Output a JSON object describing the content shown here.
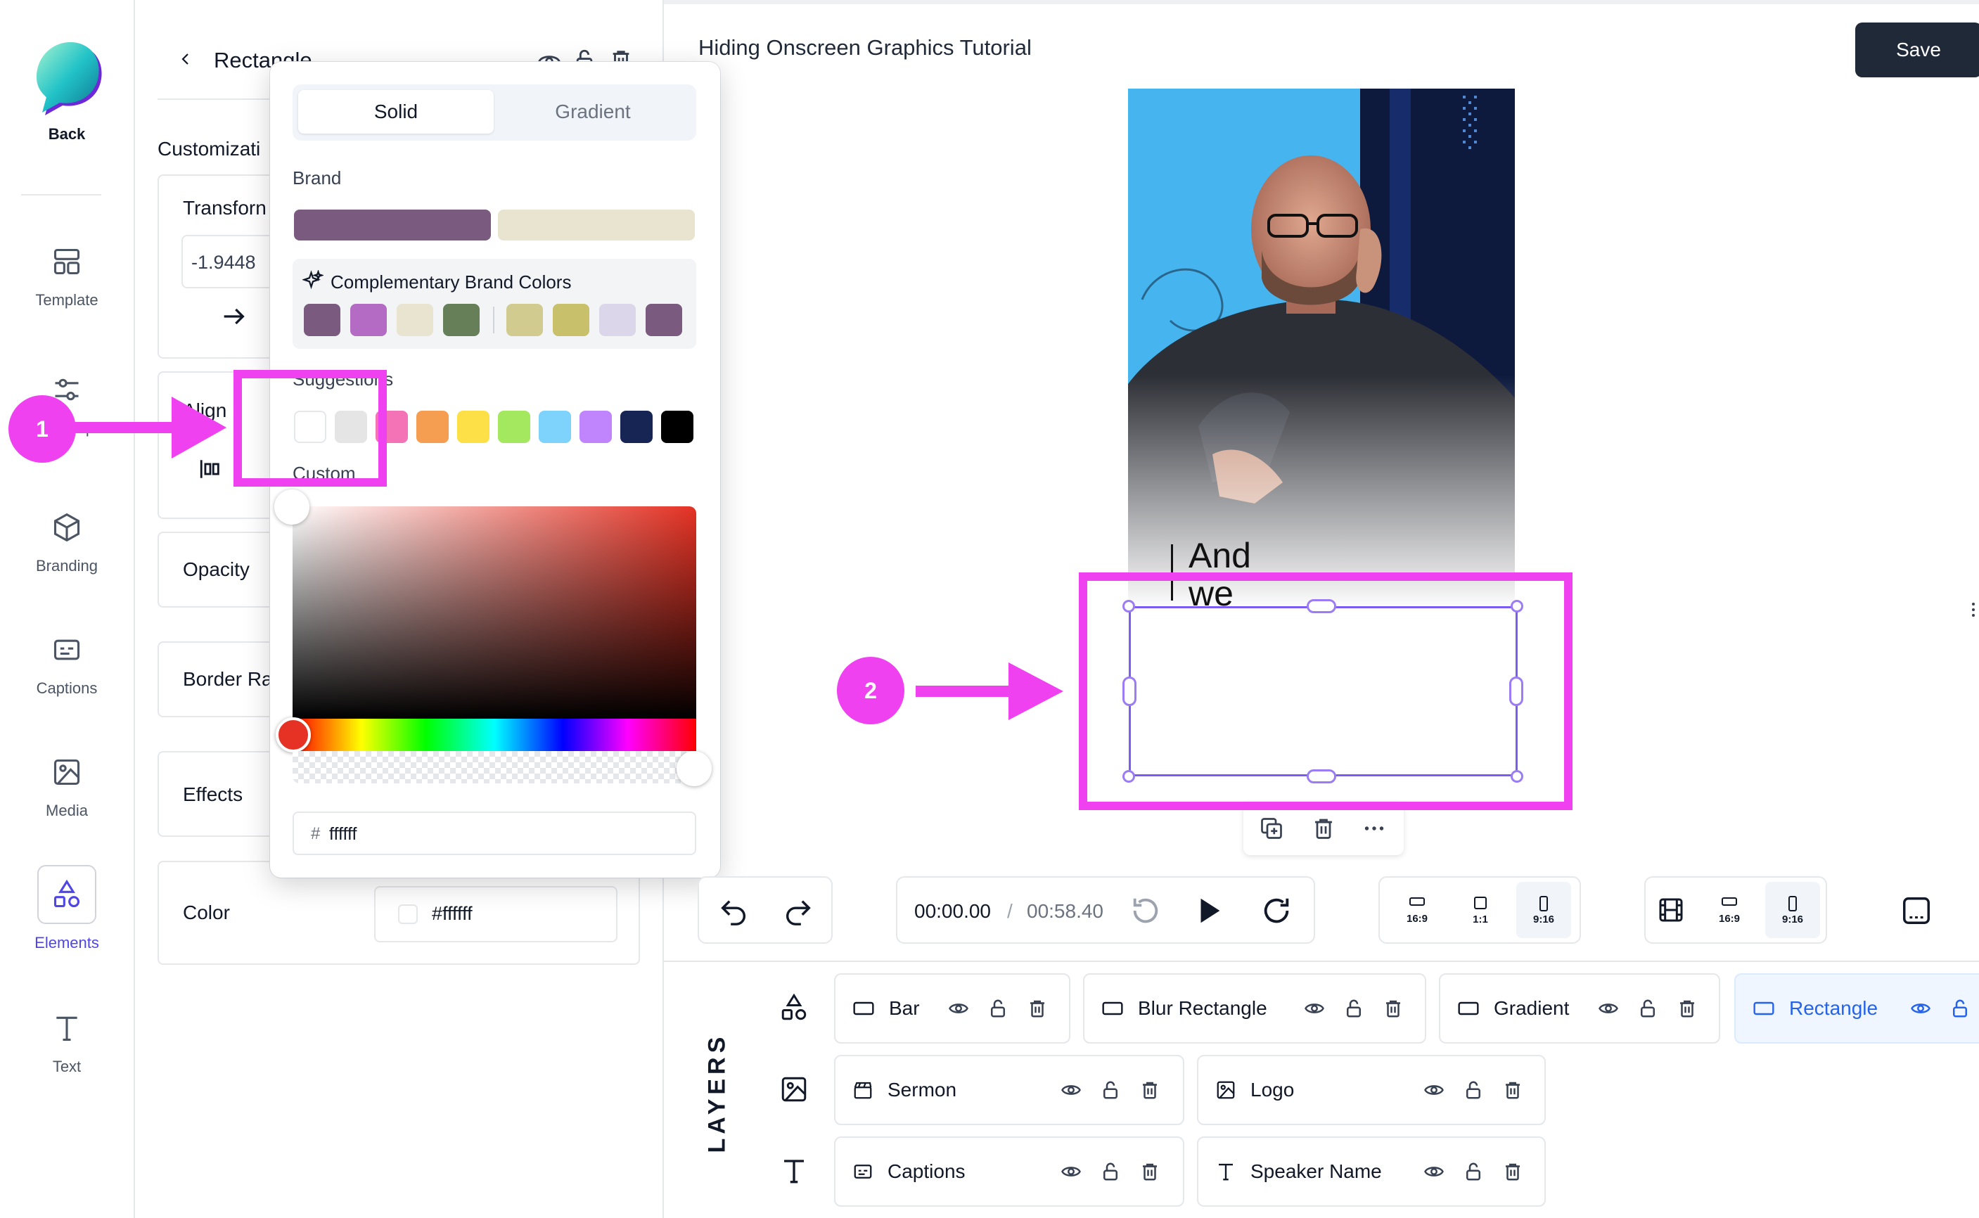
{
  "sidebar": {
    "back_label": "Back",
    "items": [
      {
        "label": "Template",
        "icon": "template-icon"
      },
      {
        "label": "Update Inputs",
        "icon": "sliders-icon"
      },
      {
        "label": "Branding",
        "icon": "cube-icon"
      },
      {
        "label": "Captions",
        "icon": "captions-icon"
      },
      {
        "label": "Media",
        "icon": "image-icon"
      },
      {
        "label": "Elements",
        "icon": "shapes-icon",
        "active": true
      },
      {
        "label": "Text",
        "icon": "text-icon"
      }
    ]
  },
  "panel": {
    "title": "Rectangle",
    "section": "Customizati",
    "transform_label": "Transforn",
    "transform_value": "-1.9448",
    "align_label": "Align",
    "opacity_label": "Opacity",
    "border_radius_label": "Border Ra",
    "effects_label": "Effects",
    "color_label": "Color",
    "color_value": "#ffffff"
  },
  "color_picker": {
    "tabs": [
      "Solid",
      "Gradient"
    ],
    "active_tab": "Solid",
    "brand_label": "Brand",
    "brand_colors": [
      "#7a5a7e",
      "#e8e4d0"
    ],
    "complementary_label": "Complementary Brand Colors",
    "complementary_colors": [
      "#7a5a7e",
      "#b36bc4",
      "#e8e4d0",
      "#667f58",
      "#d2cb8f",
      "#c9c06b",
      "#dcd6ea",
      "#7a5a7e"
    ],
    "suggestions_label": "Suggestions",
    "suggestion_colors": [
      "#ffffff",
      "#e5e5e5",
      "#f472b6",
      "#f59e52",
      "#fde047",
      "#a3e85f",
      "#7dd3fc",
      "#c084fc",
      "#172554",
      "#000000"
    ],
    "custom_label": "Custom",
    "hex_prefix": "#",
    "hex_value": "ffffff"
  },
  "main": {
    "title": "Hiding Onscreen Graphics Tutorial",
    "save_label": "Save",
    "caption_line1": "And",
    "caption_line2": "we"
  },
  "toolbar": {
    "current_time": "00:00.00",
    "separator": "/",
    "total_time": "00:58.40",
    "ratios_a": [
      "16:9",
      "1:1",
      "9:16"
    ],
    "ratios_b": [
      "16:9",
      "9:16"
    ],
    "active_ratio": "9:16"
  },
  "layers": {
    "heading": "LAYERS",
    "rows": [
      [
        {
          "name": "Bar",
          "icon": "rectangle-icon"
        },
        {
          "name": "Blur Rectangle",
          "icon": "rectangle-icon"
        },
        {
          "name": "Gradient",
          "icon": "rectangle-icon"
        },
        {
          "name": "Rectangle",
          "icon": "rectangle-icon",
          "selected": true
        }
      ],
      [
        {
          "name": "Sermon",
          "icon": "clapper-icon"
        },
        {
          "name": "Logo",
          "icon": "image-icon"
        }
      ],
      [
        {
          "name": "Captions",
          "icon": "captions-icon"
        },
        {
          "name": "Speaker Name",
          "icon": "text-icon"
        }
      ]
    ]
  },
  "annotations": {
    "badge_1": "1",
    "badge_2": "2",
    "highlight_color": "#f041f0"
  }
}
